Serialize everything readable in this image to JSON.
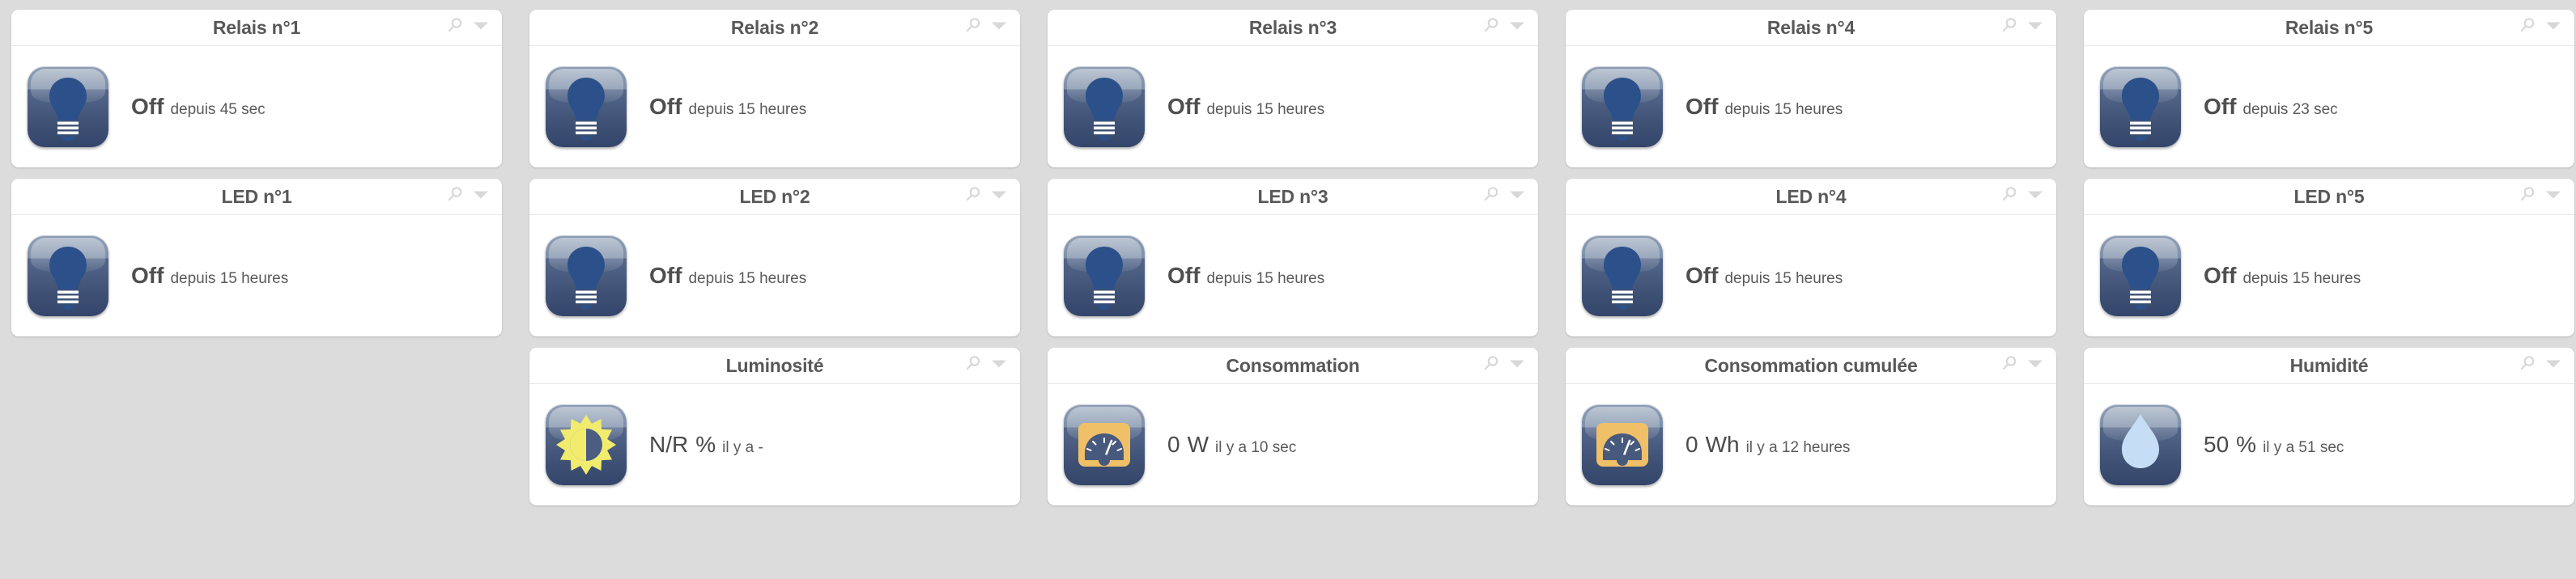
{
  "theme": {
    "page_background": "#dcdcdc",
    "card_background": "#ffffff",
    "title_color": "#585858",
    "value_color": "#4a4a4a",
    "tile_blue_dark": "#33456a",
    "tile_blue_light": "#8d9db4",
    "bulb_blue": "#2c5089",
    "sun_yellow": "#f2ec6e",
    "gauge_orange": "#f0c068",
    "droplet_blue": "#c6def5",
    "icon_gray": "#d8d8d8"
  },
  "header_tools": {
    "search_icon": "search-icon",
    "search_label": "Rechercher",
    "chevron_icon": "chevron-down-icon",
    "chevron_label": "Options"
  },
  "rows": [
    {
      "name": "relais-row",
      "cards": [
        {
          "title": "Relais n°1",
          "icon": "lightbulb-icon",
          "state": "Off",
          "state_bold": true,
          "detail": "depuis 45 sec",
          "unit": ""
        },
        {
          "title": "Relais n°2",
          "icon": "lightbulb-icon",
          "state": "Off",
          "state_bold": true,
          "detail": "depuis 15 heures",
          "unit": ""
        },
        {
          "title": "Relais n°3",
          "icon": "lightbulb-icon",
          "state": "Off",
          "state_bold": true,
          "detail": "depuis 15 heures",
          "unit": ""
        },
        {
          "title": "Relais n°4",
          "icon": "lightbulb-icon",
          "state": "Off",
          "state_bold": true,
          "detail": "depuis 15 heures",
          "unit": ""
        },
        {
          "title": "Relais n°5",
          "icon": "lightbulb-icon",
          "state": "Off",
          "state_bold": true,
          "detail": "depuis 23 sec",
          "unit": ""
        }
      ]
    },
    {
      "name": "led-row",
      "cards": [
        {
          "title": "LED n°1",
          "icon": "lightbulb-icon",
          "state": "Off",
          "state_bold": true,
          "detail": "depuis 15 heures",
          "unit": ""
        },
        {
          "title": "LED n°2",
          "icon": "lightbulb-icon",
          "state": "Off",
          "state_bold": true,
          "detail": "depuis 15 heures",
          "unit": ""
        },
        {
          "title": "LED n°3",
          "icon": "lightbulb-icon",
          "state": "Off",
          "state_bold": true,
          "detail": "depuis 15 heures",
          "unit": ""
        },
        {
          "title": "LED n°4",
          "icon": "lightbulb-icon",
          "state": "Off",
          "state_bold": true,
          "detail": "depuis 15 heures",
          "unit": ""
        },
        {
          "title": "LED n°5",
          "icon": "lightbulb-icon",
          "state": "Off",
          "state_bold": true,
          "detail": "depuis 15 heures",
          "unit": ""
        }
      ]
    },
    {
      "name": "sensor-row",
      "cards": [
        null,
        {
          "title": "Luminosité",
          "icon": "brightness-sun-icon",
          "state": "N/R",
          "state_bold": false,
          "unit": "%",
          "detail": "il y a -"
        },
        {
          "title": "Consommation",
          "icon": "gauge-icon",
          "state": "0",
          "state_bold": false,
          "unit": "W",
          "detail": "il y a 10 sec"
        },
        {
          "title": "Consommation cumulée",
          "icon": "gauge-icon",
          "state": "0",
          "state_bold": false,
          "unit": "Wh",
          "detail": "il y a 12 heures"
        },
        {
          "title": "Humidité",
          "icon": "droplet-icon",
          "state": "50",
          "state_bold": false,
          "unit": "%",
          "detail": "il y a 51 sec"
        }
      ]
    }
  ]
}
